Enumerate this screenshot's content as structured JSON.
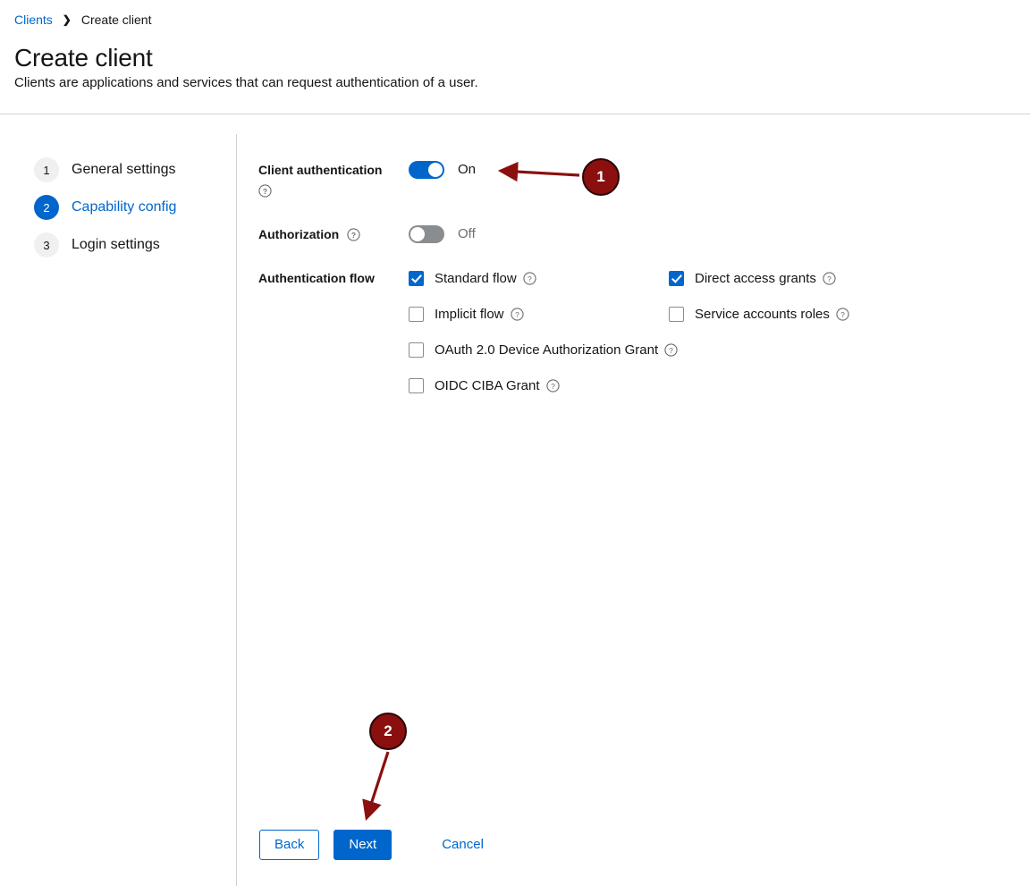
{
  "breadcrumb": {
    "parent": "Clients",
    "separator": "❯",
    "current": "Create client"
  },
  "header": {
    "title": "Create client",
    "subtitle": "Clients are applications and services that can request authentication of a user."
  },
  "wizard_nav": {
    "steps": [
      {
        "number": "1",
        "label": "General settings",
        "active": false
      },
      {
        "number": "2",
        "label": "Capability config",
        "active": true
      },
      {
        "number": "3",
        "label": "Login settings",
        "active": false
      }
    ]
  },
  "form": {
    "client_authentication": {
      "label": "Client authentication",
      "help_icon": "help-circle-icon",
      "state_label": "On",
      "enabled": true
    },
    "authorization": {
      "label": "Authorization",
      "help_icon": "help-circle-icon",
      "state_label": "Off",
      "enabled": false
    },
    "authentication_flow": {
      "label": "Authentication flow",
      "options_left": [
        {
          "label": "Standard flow",
          "checked": true,
          "help_icon": "help-circle-icon"
        },
        {
          "label": "Implicit flow",
          "checked": false,
          "help_icon": "help-circle-icon"
        },
        {
          "label": "OAuth 2.0 Device Authorization Grant",
          "checked": false,
          "help_icon": "help-circle-icon"
        },
        {
          "label": "OIDC CIBA Grant",
          "checked": false,
          "help_icon": "help-circle-icon"
        }
      ],
      "options_right": [
        {
          "label": "Direct access grants",
          "checked": true,
          "help_icon": "help-circle-icon"
        },
        {
          "label": "Service accounts roles",
          "checked": false,
          "help_icon": "help-circle-icon"
        }
      ]
    }
  },
  "footer": {
    "back_label": "Back",
    "next_label": "Next",
    "cancel_label": "Cancel"
  },
  "annotations": {
    "markers": [
      {
        "number": "1",
        "points_to": "client-authentication-toggle"
      },
      {
        "number": "2",
        "points_to": "next-button"
      }
    ],
    "color": "#8b0f0f"
  },
  "colors": {
    "accent": "#0066cc",
    "annotation": "#8b0f0f",
    "muted_text": "#6a6e73",
    "toggle_off": "#8a8d90",
    "divider": "#d2d2d2"
  }
}
